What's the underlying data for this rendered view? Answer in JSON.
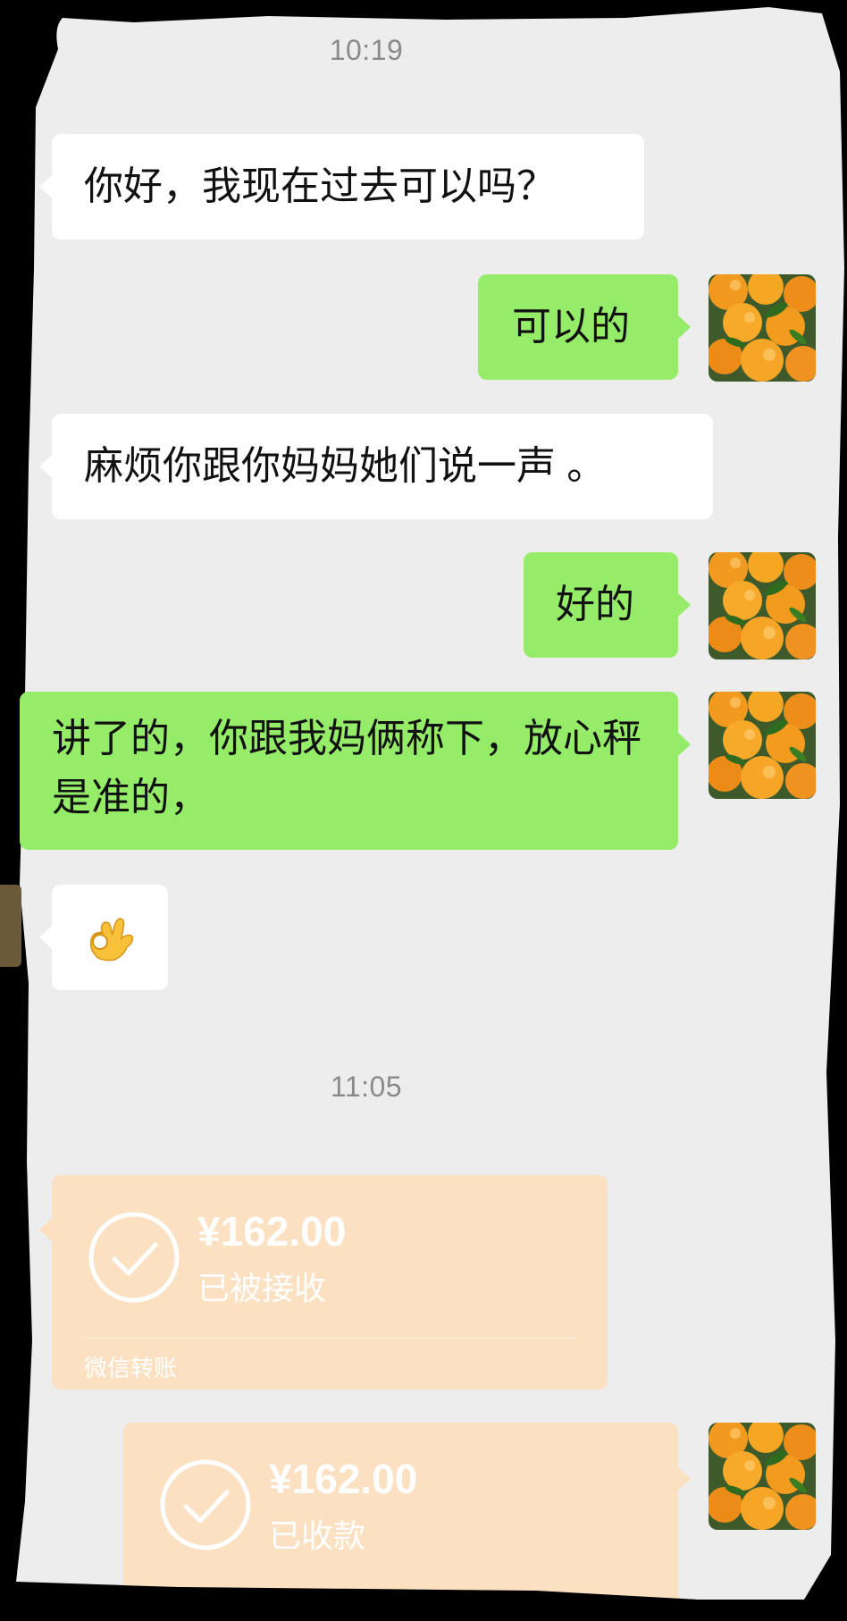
{
  "chat": {
    "time_1": "10:19",
    "time_2": "11:05",
    "messages": [
      {
        "side": "in",
        "text": "你好，我现在过去可以吗？"
      },
      {
        "side": "out",
        "text": "可以的"
      },
      {
        "side": "in",
        "text": "麻烦你跟你妈妈她们说一声 。"
      },
      {
        "side": "out",
        "text": "好的"
      },
      {
        "side": "out",
        "text": "讲了的，你跟我妈俩称下，放心秤是准的，"
      },
      {
        "side": "in",
        "emoji": "ok-hand-emoji"
      }
    ],
    "transfers": [
      {
        "side": "in",
        "amount": "¥162.00",
        "status": "已被接收",
        "footer": "微信转账"
      },
      {
        "side": "out",
        "amount": "¥162.00",
        "status": "已收款"
      }
    ]
  },
  "colors": {
    "chat_background": "#ededed",
    "outgoing_bubble": "#95ec69",
    "incoming_bubble": "#ffffff",
    "transfer_bubble": "#fbe0c1",
    "time_text": "#8a8a8a",
    "outer_background": "#000000"
  },
  "icons": {
    "avatar": "oranges-photo-avatar",
    "transfer_status": "check-circle-icon"
  }
}
